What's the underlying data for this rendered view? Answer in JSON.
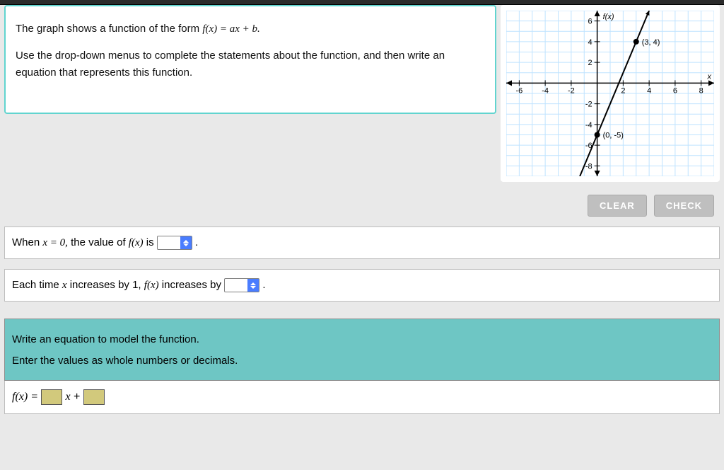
{
  "problem": {
    "p1_pre": "The graph shows a function of the form ",
    "p1_fx": "f(x)  =  ax + b.",
    "p2": "Use the drop-down menus to complete the statements about the function, and then write an equation that represents this function."
  },
  "actions": {
    "clear": "CLEAR",
    "check": "CHECK"
  },
  "statement1": {
    "pre": "When ",
    "eq": "x  =  0,",
    "mid": " the value of ",
    "fx": "f(x)",
    "post": " is ",
    "period": "."
  },
  "statement2": {
    "pre": "Each time ",
    "x": "x",
    "mid1": " increases by 1, ",
    "fx": "f(x)",
    "mid2": " increases by ",
    "period": "."
  },
  "equation": {
    "line1": "Write an equation to model the function.",
    "line2": "Enter the values as whole numbers or decimals.",
    "lhs": "f(x)  = ",
    "x": "x",
    "plus": " + "
  },
  "chart_data": {
    "type": "line",
    "title": "",
    "xlabel": "x",
    "ylabel": "f(x)",
    "xlim": [
      -7,
      9
    ],
    "ylim": [
      -9,
      7
    ],
    "xticks": [
      -6,
      -4,
      -2,
      2,
      4,
      6,
      8
    ],
    "yticks": [
      -8,
      -6,
      -4,
      -2,
      2,
      4,
      6
    ],
    "points_labeled": [
      {
        "x": 0,
        "y": -5,
        "label": "(0, -5)"
      },
      {
        "x": 3,
        "y": 4,
        "label": "(3, 4)"
      }
    ],
    "line_equation": {
      "a": 3,
      "b": -5
    }
  }
}
